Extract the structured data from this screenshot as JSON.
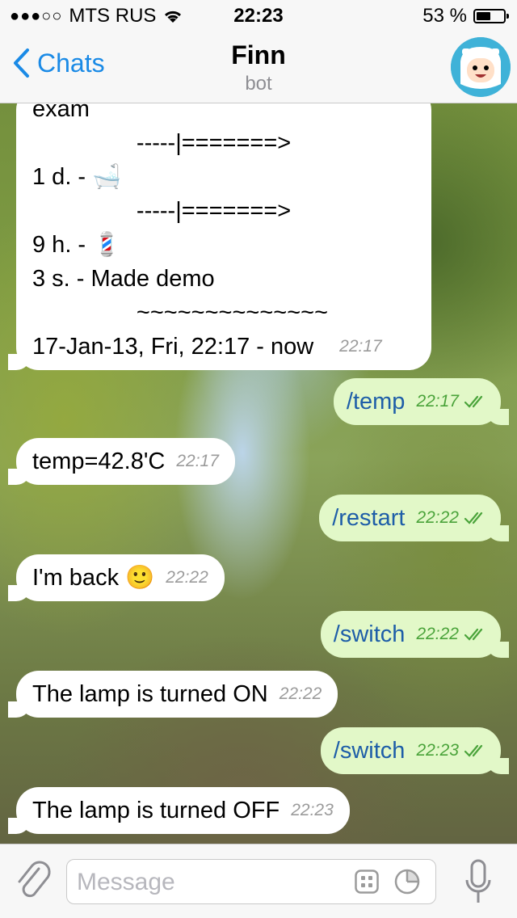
{
  "status_bar": {
    "signal": "●●●○○",
    "carrier": "MTS RUS",
    "time": "22:23",
    "battery_text": "53 %",
    "battery_level": 0.53
  },
  "nav": {
    "back_label": "Chats",
    "title": "Finn",
    "subtitle": "bot"
  },
  "messages": {
    "m1": {
      "lines": [
        "exam",
        "                -----|=======>",
        "1 d. - 🛁",
        "                -----|=======>",
        "9 h. - 💈",
        "3 s. - Made demo",
        "                ~~~~~~~~~~~~~~",
        "17-Jan-13, Fri, 22:17 - now"
      ],
      "time": "22:17"
    },
    "m2": {
      "text": "/temp",
      "time": "22:17"
    },
    "m3": {
      "text": "temp=42.8'C",
      "time": "22:17"
    },
    "m4": {
      "text": "/restart",
      "time": "22:22"
    },
    "m5": {
      "text": "I'm back 🙂",
      "time": "22:22"
    },
    "m6": {
      "text": "/switch",
      "time": "22:22"
    },
    "m7": {
      "text": "The lamp is turned ON",
      "time": "22:22"
    },
    "m8": {
      "text": "/switch",
      "time": "22:23"
    },
    "m9": {
      "text": "The lamp is turned OFF",
      "time": "22:23"
    }
  },
  "input": {
    "placeholder": "Message"
  },
  "colors": {
    "accent": "#1a8ae6",
    "outgoing_bubble": "#e2f8c8",
    "incoming_bubble": "#ffffff",
    "read_ticks": "#4aa33a"
  },
  "icons": {
    "back": "chevron-left-icon",
    "attach": "paperclip-icon",
    "keyboard": "bot-keyboard-icon",
    "sticker": "moon-icon",
    "mic": "microphone-icon"
  }
}
